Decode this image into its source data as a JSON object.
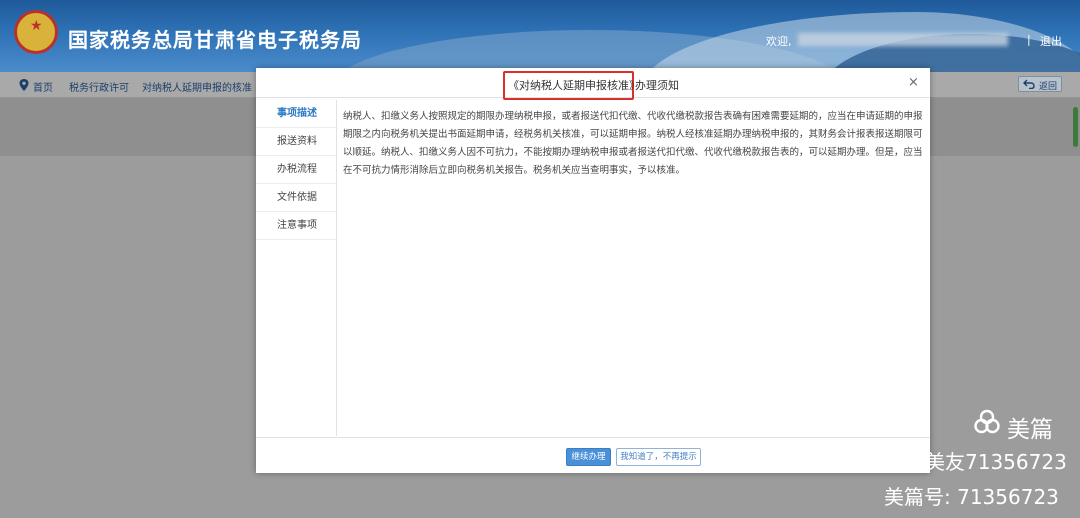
{
  "header": {
    "site_title": "国家税务总局甘肃省电子税务局",
    "welcome": "欢迎,",
    "separator": "|",
    "logout": "退出"
  },
  "breadcrumb": {
    "home": "首页",
    "level1": "税务行政许可",
    "level2": "对纳税人延期申报的核准",
    "back": "返回"
  },
  "modal": {
    "title": "《对纳税人延期申报核准》",
    "title_suffix": "办理须知",
    "close": "×",
    "sidebar": [
      {
        "label": "事项描述",
        "active": true
      },
      {
        "label": "报送资料",
        "active": false
      },
      {
        "label": "办税流程",
        "active": false
      },
      {
        "label": "文件依据",
        "active": false
      },
      {
        "label": "注意事项",
        "active": false
      }
    ],
    "content": "纳税人、扣缴义务人按照规定的期限办理纳税申报，或者报送代扣代缴、代收代缴税款报告表确有困难需要延期的，应当在申请延期的申报期限之内向税务机关提出书面延期申请，经税务机关核准，可以延期申报。纳税人经核准延期办理纳税申报的，其财务会计报表报送期限可以顺延。纳税人、扣缴义务人因不可抗力，不能按期办理纳税申报或者报送代扣代缴、代收代缴税款报告表的，可以延期办理。但是，应当在不可抗力情形消除后立即向税务机关报告。税务机关应当查明事实，予以核准。",
    "btn_continue": "继续办理",
    "btn_ok": "我知道了，不再提示"
  },
  "watermark": {
    "brand": "美篇",
    "line1": "美友71356723",
    "line2": "美篇号: 71356723"
  },
  "colors": {
    "header_blue": "#2e72b6",
    "highlight_red": "#d9302a",
    "active_blue": "#2b79c2"
  }
}
